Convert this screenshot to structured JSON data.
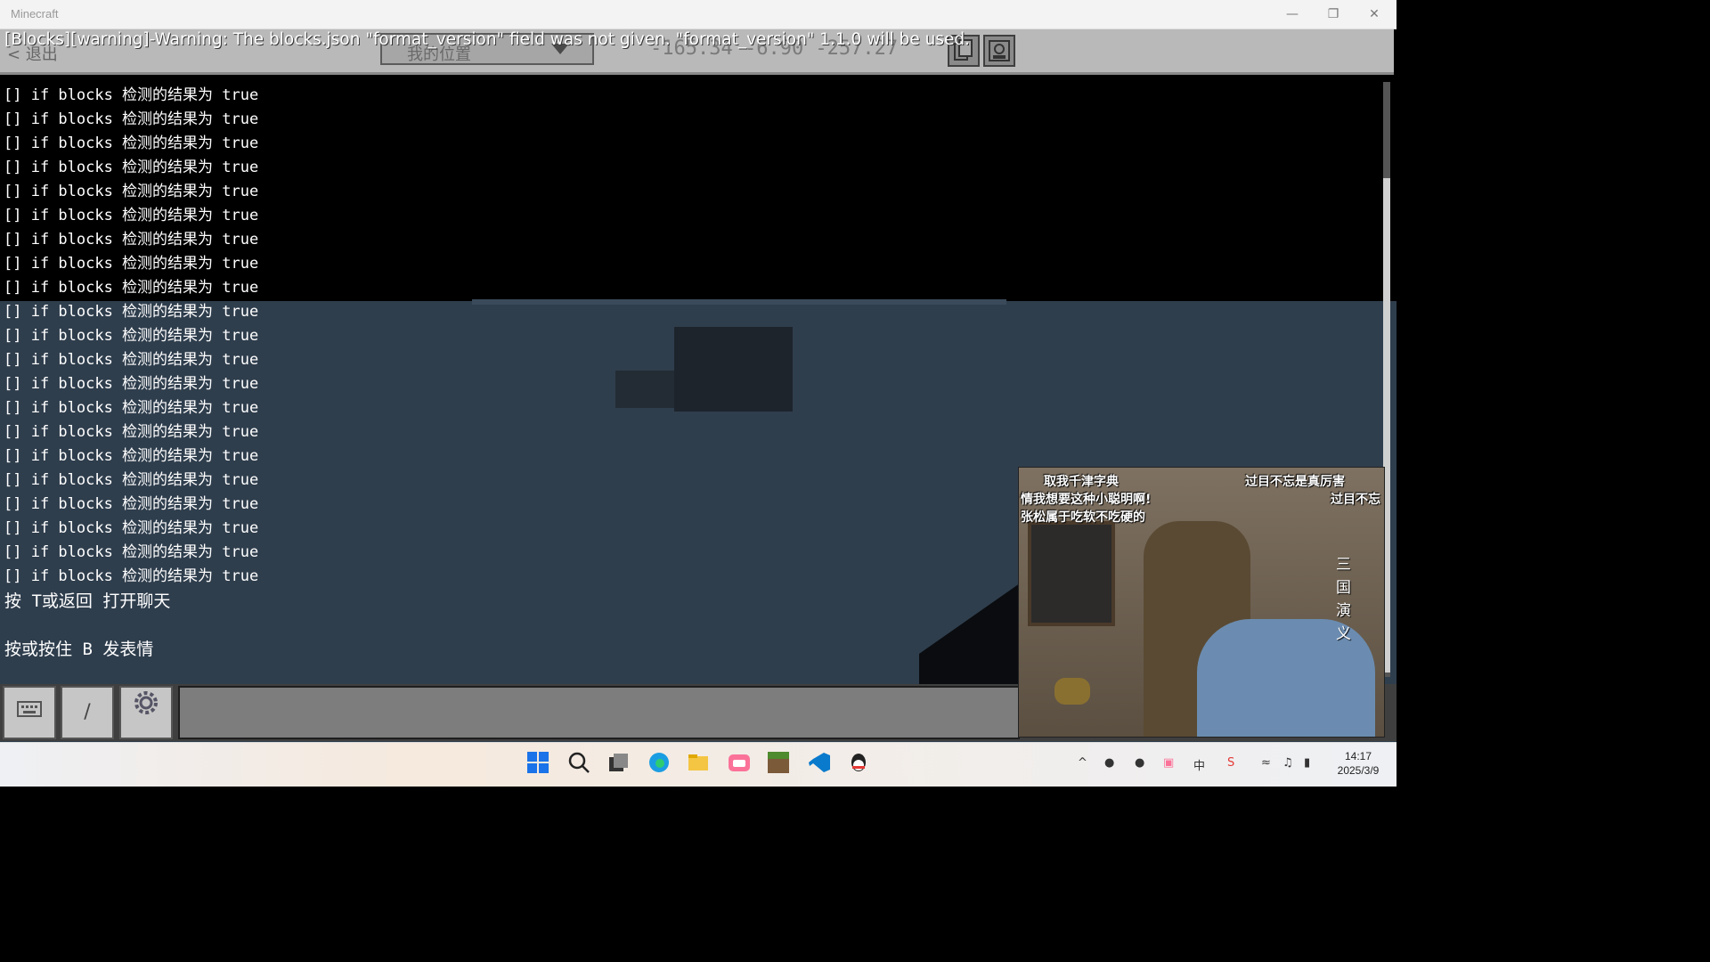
{
  "window": {
    "title": "Minecraft"
  },
  "hud": {
    "back_label": "< 退出",
    "position_dropdown": "我的位置",
    "coordinates": "-165.34 -6.90 -257.27"
  },
  "warning": "[Blocks][warning]-Warning: The blocks.json \"format_version\" field was not given. \"format_version\" 1.1.0 will be used.",
  "chat": {
    "lines": [
      "[] if blocks 检测的结果为 true",
      "[] if blocks 检测的结果为 true",
      "[] if blocks 检测的结果为 true",
      "[] if blocks 检测的结果为 true",
      "[] if blocks 检测的结果为 true",
      "[] if blocks 检测的结果为 true",
      "[] if blocks 检测的结果为 true",
      "[] if blocks 检测的结果为 true",
      "[] if blocks 检测的结果为 true",
      "[] if blocks 检测的结果为 true",
      "[] if blocks 检测的结果为 true",
      "[] if blocks 检测的结果为 true",
      "[] if blocks 检测的结果为 true",
      "[] if blocks 检测的结果为 true",
      "[] if blocks 检测的结果为 true",
      "[] if blocks 检测的结果为 true",
      "[] if blocks 检测的结果为 true",
      "[] if blocks 检测的结果为 true",
      "[] if blocks 检测的结果为 true",
      "[] if blocks 检测的结果为 true",
      "[] if blocks 检测的结果为 true"
    ],
    "hint_open": "按 T或返回 打开聊天",
    "hint_emote": "按或按住 B 发表情"
  },
  "input_bar": {
    "keyboard_icon": "keyboard-icon",
    "slash_label": "/",
    "settings_icon": "gear-icon"
  },
  "video": {
    "danmaku": [
      "取我千津字典",
      "情我想要这种小聪明啊!",
      "张松属于吃软不吃硬的",
      "过目不忘是真厉害",
      "过目不忘"
    ],
    "title_vertical": "三国演义"
  },
  "taskbar": {
    "apps": [
      "windows-start-icon",
      "search-icon",
      "task-view-icon",
      "edge-icon",
      "file-explorer-icon",
      "bilibili-icon",
      "minecraft-icon",
      "vscode-icon",
      "qq-icon"
    ],
    "time": "14:17",
    "date": "2025/3/9"
  }
}
